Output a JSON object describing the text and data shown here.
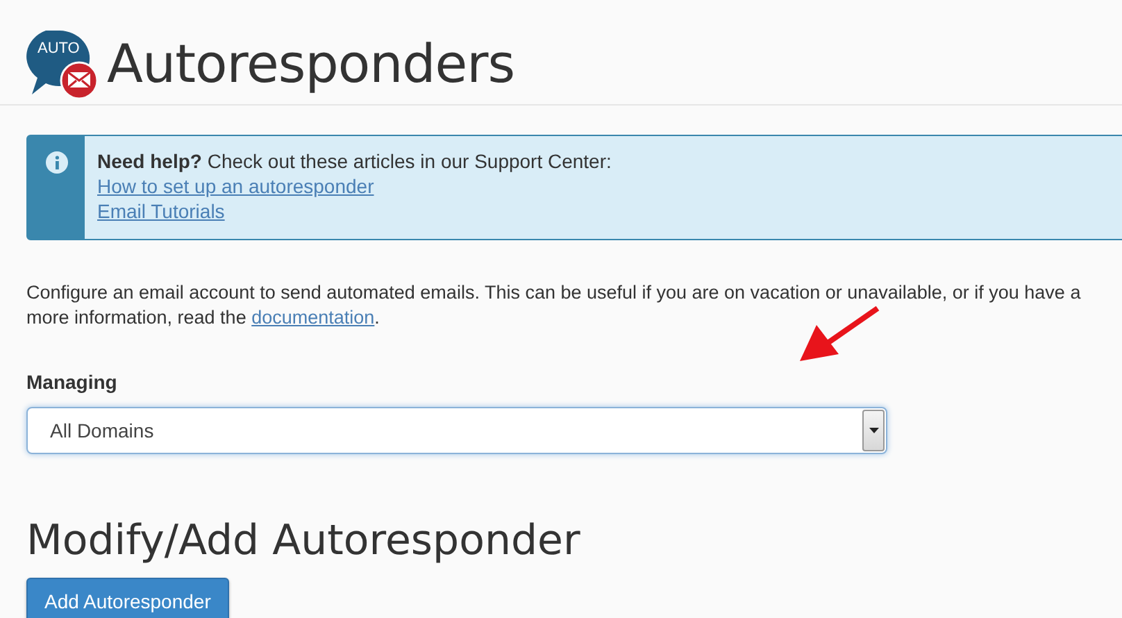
{
  "header": {
    "logo_text": "AUTO",
    "title": "Autoresponders"
  },
  "help": {
    "lead": "Need help?",
    "text": "Check out these articles in our Support Center:",
    "links": [
      "How to set up an autoresponder",
      "Email Tutorials"
    ]
  },
  "description": {
    "line_1": "Configure an email account to send automated emails. This can be useful if you are on vacation or unavailable, or if you have a",
    "line_2_before": "more information, read the",
    "link": "documentation",
    "line_2_after": "."
  },
  "managing": {
    "label": "Managing",
    "value": "All Domains"
  },
  "section": {
    "title": "Modify/Add Autoresponder",
    "button": "Add Autoresponder"
  }
}
